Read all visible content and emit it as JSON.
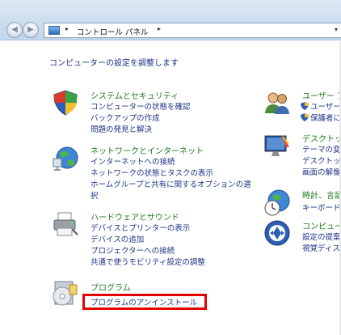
{
  "nav": {
    "back_glyph": "◀",
    "forward_glyph": "▶",
    "address_sep1": "▸",
    "address_sep2": "▸",
    "address_text": "コントロール パネル",
    "dropdown_glyph": "▾"
  },
  "page_title": "コンピューターの設定を調整します",
  "categories": {
    "system": {
      "title": "システムとセキュリティ",
      "links": [
        "コンピューターの状態を確認",
        "バックアップの作成",
        "問題の発見と解決"
      ]
    },
    "network": {
      "title": "ネットワークとインターネット",
      "links": [
        "インターネットへの接続",
        "ネットワークの状態とタスクの表示",
        "ホームグループと共有に関するオプションの選",
        "択"
      ]
    },
    "hardware": {
      "title": "ハードウェアとサウンド",
      "links": [
        "デバイスとプリンターの表示",
        "デバイスの追加",
        "プロジェクターへの接続",
        "共通で使うモビリティ設定の調整"
      ]
    },
    "programs": {
      "title": "プログラム",
      "links": [
        "プログラムのアンインストール"
      ]
    },
    "user": {
      "title": "ユーザー ア",
      "links": [
        "ユーザー",
        "保護者に"
      ]
    },
    "appearance": {
      "title": "デスクトップ",
      "links": [
        "テーマの変",
        "デスクトップ",
        "画面の解像"
      ]
    },
    "clock": {
      "title": "時計、言語",
      "links": [
        "キーボード"
      ]
    },
    "ease": {
      "title": "コンピュー",
      "links": [
        "設定の提案",
        "視覚ディス"
      ]
    }
  },
  "colors": {
    "category_title": "#1e7a1e",
    "link": "#1e3287",
    "highlight_box": "#e60000"
  }
}
